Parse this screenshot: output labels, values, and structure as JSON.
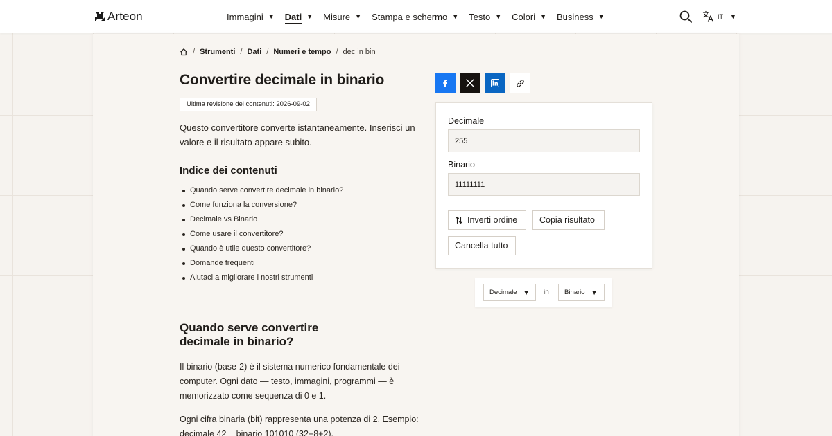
{
  "header": {
    "brand": "Arteon",
    "nav": [
      {
        "label": "Immagini",
        "active": false
      },
      {
        "label": "Dati",
        "active": true
      },
      {
        "label": "Misure",
        "active": false
      },
      {
        "label": "Stampa e schermo",
        "active": false
      },
      {
        "label": "Testo",
        "active": false
      },
      {
        "label": "Colori",
        "active": false
      },
      {
        "label": "Business",
        "active": false
      }
    ],
    "caret": "▼",
    "search_icon": "search-icon",
    "language": {
      "icon": "translate-icon",
      "code": "IT"
    }
  },
  "breadcrumb": {
    "home_icon": "home-icon",
    "separator": "/",
    "items": [
      "Strumenti",
      "Dati",
      "Numeri e tempo"
    ],
    "current": "dec in bin"
  },
  "page": {
    "title": "Convertire decimale in binario",
    "revision": "Ultima revisione dei contenuti: 2026-09-02",
    "intro": "Questo convertitore converte istantaneamente. Inserisci un valore e il risultato appare subito."
  },
  "toc": {
    "title": "Indice dei contenuti",
    "items": [
      "Quando serve convertire decimale in binario?",
      "Come funziona la conversione?",
      "Decimale vs Binario",
      "Come usare il convertitore?",
      "Quando è utile questo convertitore?",
      "Domande frequenti",
      "Aiutaci a migliorare i nostri strumenti"
    ]
  },
  "section": {
    "title": "Quando serve convertire decimale in binario?",
    "paragraphs": [
      "Il binario (base-2) è il sistema numerico fondamentale dei computer. Ogni dato — testo, immagini, programmi — è memorizzato come sequenza di 0 e 1.",
      "Ogni cifra binaria (bit) rappresenta una potenza di 2. Esempio: decimale 42 = binario 101010 (32+8+2)."
    ]
  },
  "share": {
    "icons": [
      "facebook-icon",
      "x-icon",
      "linkedin-icon",
      "link-icon"
    ],
    "colors": {
      "facebook": "#1877f2",
      "x": "#16120f",
      "linkedin": "#0a66c2"
    }
  },
  "converter": {
    "input_label": "Decimale",
    "input_value": "255",
    "output_label": "Binario",
    "output_value": "11111111",
    "swap_label": "Inverti ordine",
    "copy_label": "Copia risultato",
    "clear_label": "Cancella tutto"
  },
  "units": {
    "from": "Decimale",
    "connector": "in",
    "to": "Binario"
  }
}
